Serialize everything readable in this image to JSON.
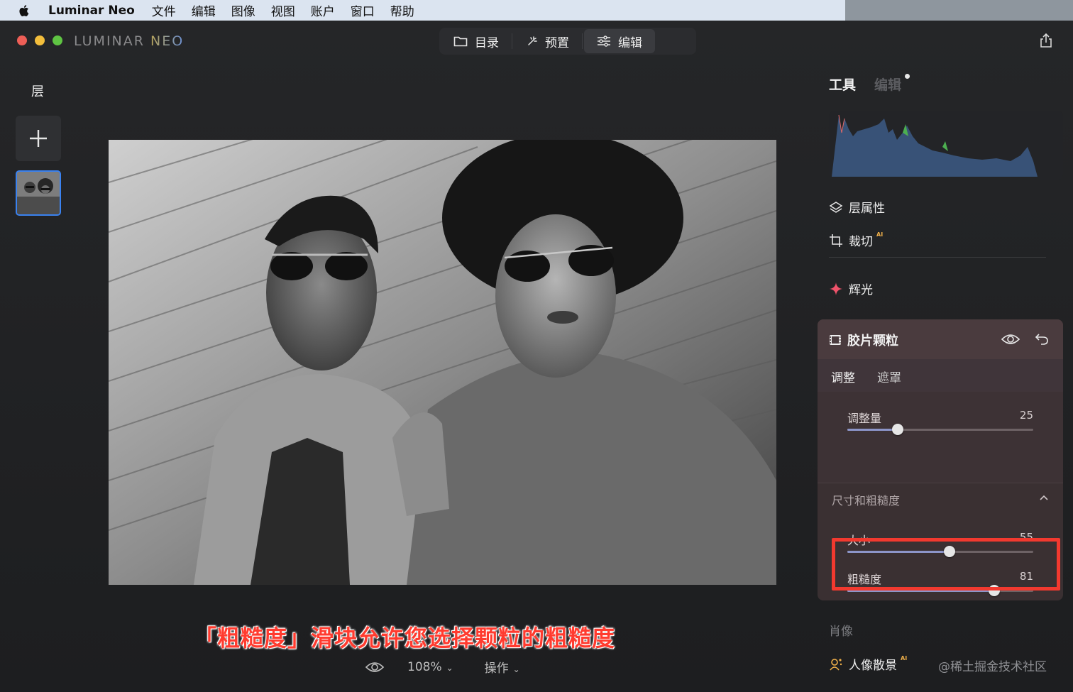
{
  "menubar": {
    "app_name": "Luminar Neo",
    "items": [
      "文件",
      "编辑",
      "图像",
      "视图",
      "账户",
      "窗口",
      "帮助"
    ]
  },
  "window": {
    "logo_left": "LUMINAR",
    "logo_right": "NEO",
    "modes": [
      {
        "label": "目录",
        "icon": "folder-icon"
      },
      {
        "label": "预置",
        "icon": "sparkle-icon"
      },
      {
        "label": "编辑",
        "icon": "sliders-icon"
      }
    ],
    "active_mode": "编辑"
  },
  "layers": {
    "title": "层"
  },
  "canvas": {
    "caption": "「粗糙度」滑块允许您选择颗粒的粗糙度",
    "zoom": "108%",
    "actions": "操作"
  },
  "panel": {
    "tab_tools": "工具",
    "tab_edits": "编辑",
    "tools": {
      "layer_props": "层属性",
      "crop": "裁切",
      "crop_badge": "AI",
      "glow": "辉光"
    },
    "grain": {
      "title": "胶片颗粒",
      "subtab_adjust": "调整",
      "subtab_mask": "遮罩",
      "amount_label": "调整量",
      "amount_value": "25",
      "amount_fraction": 0.27,
      "section_title": "尺寸和粗糙度",
      "size_label": "大小",
      "size_value": "55",
      "size_fraction": 0.55,
      "roughness_label": "粗糙度",
      "roughness_value": "81",
      "roughness_fraction": 0.79
    },
    "portrait_header": "肖像",
    "portrait_bokeh": "人像散景",
    "portrait_bokeh_badge": "AI"
  },
  "watermark": "@稀土掘金技术社区",
  "colors": {
    "highlight": "#f2392f",
    "caption": "#ff3b2f",
    "slider_fill": "#8c95c9",
    "glow_icon": "#f0536b",
    "bokeh_icon": "#f0b04a"
  }
}
